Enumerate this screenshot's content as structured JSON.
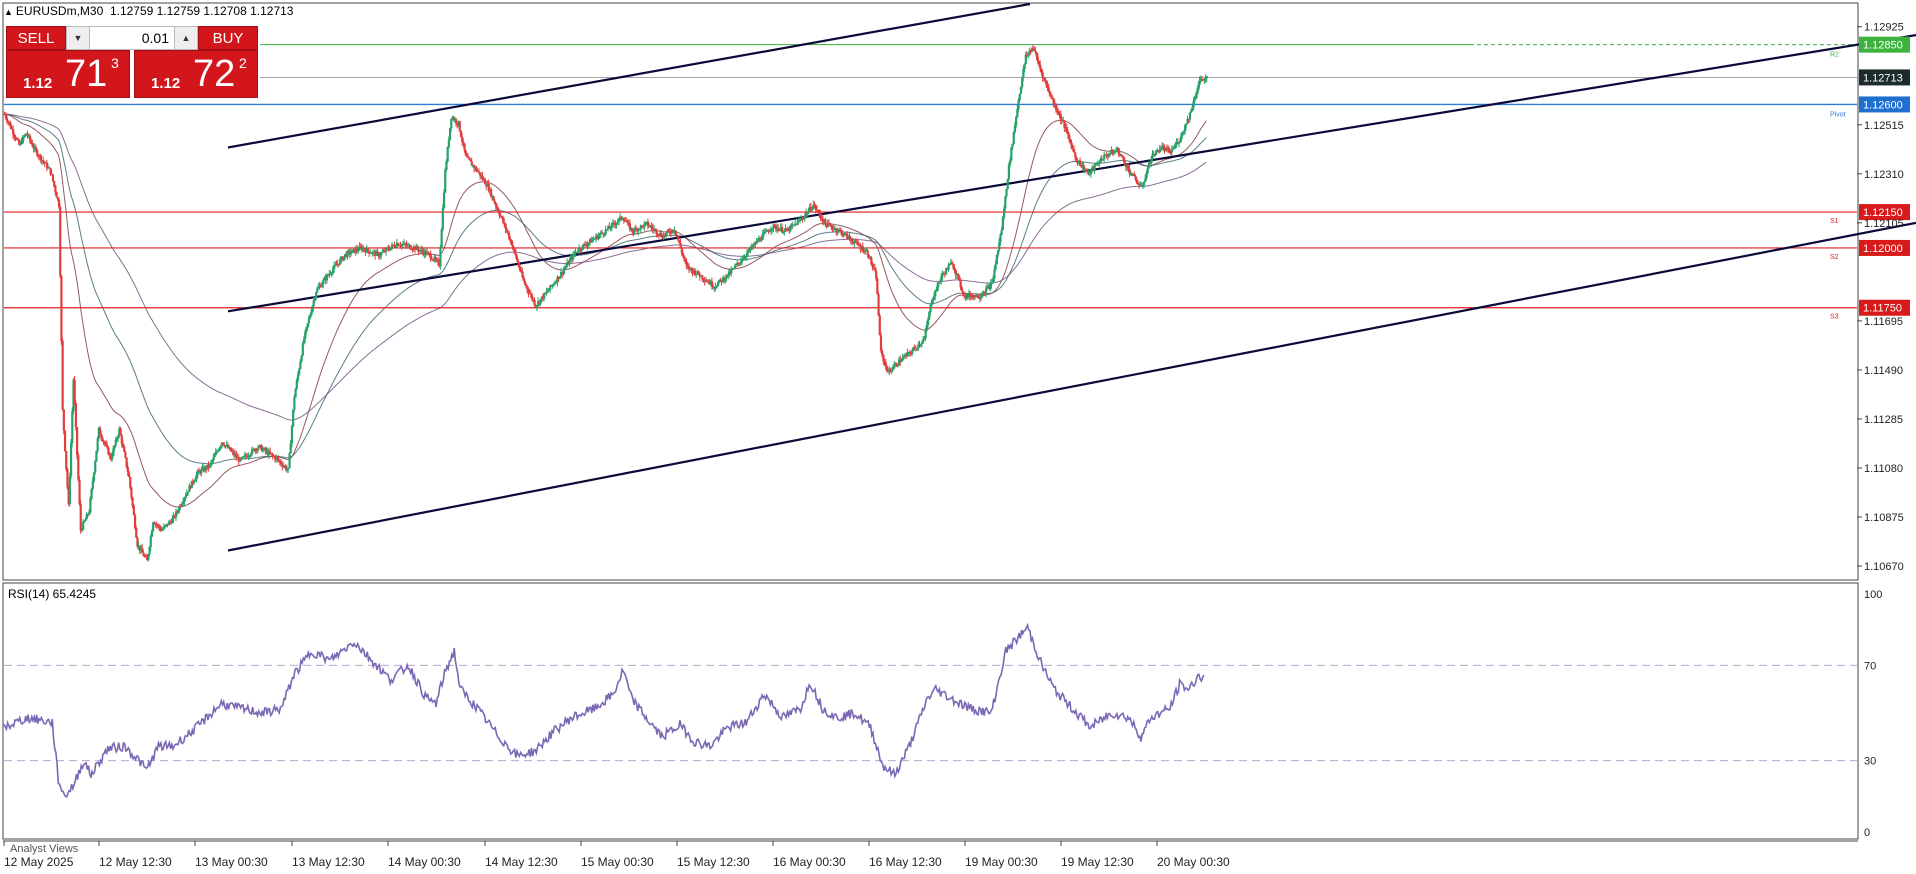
{
  "header": {
    "symbol": "EURUSDm,M30",
    "ohlc": "1.12759 1.12759 1.12708 1.12713"
  },
  "trade_panel": {
    "sell_label": "SELL",
    "buy_label": "BUY",
    "lot": "0.01",
    "sell_small": "1.12",
    "sell_big": "71",
    "sell_sup": "3",
    "buy_small": "1.12",
    "buy_big": "72",
    "buy_sup": "2"
  },
  "rsi_label": "RSI(14) 65.4245",
  "analyst_label": "Analyst Views",
  "colors": {
    "bull": "#26a269",
    "bear": "#e23d3d",
    "resistance": "#e01e1e",
    "support_line": "#2e7bd6",
    "r2_line": "#3cb33c",
    "channel": "#0b0b3b",
    "rsi": "#7b68b5"
  },
  "chart_data": [
    {
      "type": "candlestick",
      "symbol": "EURUSDm",
      "timeframe": "M30",
      "x_ticks": [
        "12 May 2025",
        "12 May 12:30",
        "13 May 00:30",
        "13 May 12:30",
        "14 May 00:30",
        "14 May 12:30",
        "15 May 00:30",
        "15 May 12:30",
        "16 May 00:30",
        "16 May 12:30",
        "19 May 00:30",
        "19 May 12:30",
        "20 May 00:30"
      ],
      "y_ticks": [
        "1.12925",
        "1.12515",
        "1.12310",
        "1.12105",
        "1.11695",
        "1.11490",
        "1.11285",
        "1.11080",
        "1.10875",
        "1.10670"
      ],
      "ylim": [
        1.1062,
        1.1302
      ],
      "price_path": [
        [
          0,
          1.1256
        ],
        [
          12,
          1.1243
        ],
        [
          18,
          1.1248
        ],
        [
          25,
          1.1241
        ],
        [
          38,
          1.1232
        ],
        [
          45,
          1.1218
        ],
        [
          48,
          1.1132
        ],
        [
          53,
          1.1092
        ],
        [
          57,
          1.1145
        ],
        [
          63,
          1.1082
        ],
        [
          70,
          1.109
        ],
        [
          78,
          1.1124
        ],
        [
          88,
          1.1112
        ],
        [
          95,
          1.1124
        ],
        [
          103,
          1.1104
        ],
        [
          110,
          1.1076
        ],
        [
          118,
          1.1069
        ],
        [
          123,
          1.1086
        ],
        [
          130,
          1.1082
        ],
        [
          140,
          1.1087
        ],
        [
          150,
          1.1097
        ],
        [
          160,
          1.1106
        ],
        [
          170,
          1.1109
        ],
        [
          180,
          1.1119
        ],
        [
          195,
          1.1111
        ],
        [
          210,
          1.1117
        ],
        [
          225,
          1.1112
        ],
        [
          235,
          1.1107
        ],
        [
          240,
          1.1138
        ],
        [
          248,
          1.1162
        ],
        [
          258,
          1.1182
        ],
        [
          270,
          1.119
        ],
        [
          282,
          1.1197
        ],
        [
          295,
          1.12
        ],
        [
          310,
          1.1197
        ],
        [
          325,
          1.1202
        ],
        [
          340,
          1.12
        ],
        [
          352,
          1.1197
        ],
        [
          360,
          1.1193
        ],
        [
          365,
          1.1232
        ],
        [
          370,
          1.1255
        ],
        [
          376,
          1.1252
        ],
        [
          382,
          1.1238
        ],
        [
          392,
          1.1232
        ],
        [
          400,
          1.1226
        ],
        [
          412,
          1.1212
        ],
        [
          420,
          1.1202
        ],
        [
          430,
          1.1186
        ],
        [
          440,
          1.1176
        ],
        [
          450,
          1.1182
        ],
        [
          462,
          1.119
        ],
        [
          474,
          1.1199
        ],
        [
          486,
          1.1203
        ],
        [
          500,
          1.1208
        ],
        [
          512,
          1.1213
        ],
        [
          520,
          1.1207
        ],
        [
          532,
          1.121
        ],
        [
          545,
          1.1205
        ],
        [
          555,
          1.1208
        ],
        [
          565,
          1.1192
        ],
        [
          575,
          1.1189
        ],
        [
          588,
          1.1184
        ],
        [
          600,
          1.1189
        ],
        [
          612,
          1.1196
        ],
        [
          624,
          1.1203
        ],
        [
          636,
          1.1209
        ],
        [
          648,
          1.1207
        ],
        [
          660,
          1.1212
        ],
        [
          670,
          1.1218
        ],
        [
          680,
          1.121
        ],
        [
          692,
          1.1207
        ],
        [
          705,
          1.1202
        ],
        [
          715,
          1.1198
        ],
        [
          722,
          1.1188
        ],
        [
          726,
          1.1156
        ],
        [
          732,
          1.1148
        ],
        [
          742,
          1.1153
        ],
        [
          752,
          1.1157
        ],
        [
          762,
          1.1162
        ],
        [
          768,
          1.1178
        ],
        [
          776,
          1.1188
        ],
        [
          785,
          1.1194
        ],
        [
          795,
          1.118
        ],
        [
          808,
          1.118
        ],
        [
          818,
          1.1185
        ],
        [
          826,
          1.1208
        ],
        [
          832,
          1.1234
        ],
        [
          840,
          1.1262
        ],
        [
          846,
          1.128
        ],
        [
          852,
          1.1284
        ],
        [
          860,
          1.1272
        ],
        [
          868,
          1.1262
        ],
        [
          878,
          1.1251
        ],
        [
          888,
          1.1237
        ],
        [
          898,
          1.1231
        ],
        [
          910,
          1.1238
        ],
        [
          922,
          1.1241
        ],
        [
          932,
          1.1232
        ],
        [
          942,
          1.1225
        ],
        [
          950,
          1.1238
        ],
        [
          958,
          1.1242
        ],
        [
          966,
          1.124
        ],
        [
          974,
          1.1246
        ],
        [
          982,
          1.1256
        ],
        [
          990,
          1.127
        ],
        [
          996,
          1.1271
        ]
      ]
    },
    {
      "type": "line",
      "name": "RSI(14)",
      "ylim": [
        0,
        100
      ],
      "y_ticks": [
        "100",
        "70",
        "30",
        "0"
      ],
      "levels": [
        70,
        30
      ],
      "values": [
        [
          0,
          44
        ],
        [
          20,
          48
        ],
        [
          40,
          46
        ],
        [
          45,
          22
        ],
        [
          50,
          15
        ],
        [
          58,
          20
        ],
        [
          66,
          30
        ],
        [
          72,
          24
        ],
        [
          86,
          35
        ],
        [
          100,
          36
        ],
        [
          112,
          30
        ],
        [
          118,
          26
        ],
        [
          128,
          36
        ],
        [
          140,
          36
        ],
        [
          160,
          44
        ],
        [
          180,
          54
        ],
        [
          195,
          52
        ],
        [
          215,
          50
        ],
        [
          230,
          52
        ],
        [
          240,
          66
        ],
        [
          255,
          76
        ],
        [
          270,
          72
        ],
        [
          290,
          80
        ],
        [
          305,
          72
        ],
        [
          320,
          64
        ],
        [
          335,
          70
        ],
        [
          350,
          56
        ],
        [
          358,
          54
        ],
        [
          366,
          68
        ],
        [
          373,
          76
        ],
        [
          378,
          60
        ],
        [
          392,
          52
        ],
        [
          410,
          40
        ],
        [
          425,
          32
        ],
        [
          440,
          34
        ],
        [
          455,
          42
        ],
        [
          470,
          48
        ],
        [
          490,
          52
        ],
        [
          505,
          58
        ],
        [
          513,
          68
        ],
        [
          520,
          56
        ],
        [
          535,
          46
        ],
        [
          545,
          40
        ],
        [
          560,
          45
        ],
        [
          572,
          38
        ],
        [
          585,
          36
        ],
        [
          600,
          44
        ],
        [
          615,
          46
        ],
        [
          630,
          58
        ],
        [
          645,
          48
        ],
        [
          660,
          52
        ],
        [
          668,
          63
        ],
        [
          678,
          52
        ],
        [
          690,
          48
        ],
        [
          705,
          50
        ],
        [
          718,
          44
        ],
        [
          728,
          28
        ],
        [
          738,
          24
        ],
        [
          750,
          36
        ],
        [
          765,
          56
        ],
        [
          772,
          60
        ],
        [
          785,
          56
        ],
        [
          800,
          52
        ],
        [
          818,
          50
        ],
        [
          830,
          76
        ],
        [
          848,
          86
        ],
        [
          860,
          70
        ],
        [
          870,
          60
        ],
        [
          885,
          52
        ],
        [
          900,
          44
        ],
        [
          918,
          50
        ],
        [
          932,
          48
        ],
        [
          942,
          40
        ],
        [
          950,
          48
        ],
        [
          958,
          50
        ],
        [
          966,
          52
        ],
        [
          974,
          62
        ],
        [
          982,
          60
        ],
        [
          990,
          66
        ],
        [
          994,
          64
        ]
      ]
    }
  ],
  "levels": [
    {
      "label": "1.12850",
      "pivot_tag": "R2",
      "kind": "r2"
    },
    {
      "label": "1.12713",
      "pivot_tag": "",
      "kind": "current"
    },
    {
      "label": "1.12600",
      "pivot_tag": "Pivot",
      "kind": "pivot"
    },
    {
      "label": "1.12150",
      "pivot_tag": "S1",
      "kind": "res"
    },
    {
      "label": "1.12000",
      "pivot_tag": "S2",
      "kind": "res"
    },
    {
      "label": "1.11750",
      "pivot_tag": "S3",
      "kind": "res"
    }
  ]
}
